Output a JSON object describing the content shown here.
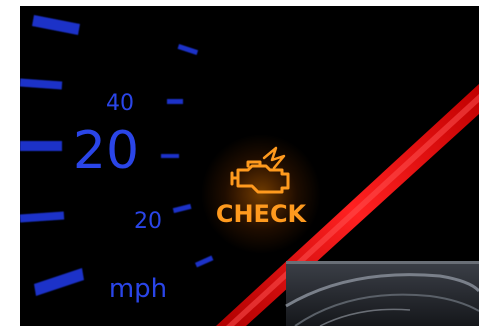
{
  "dashboard": {
    "speed_numbers": [
      "20",
      "40"
    ],
    "rpm_number": "20",
    "unit_label": "mph",
    "warning_light": {
      "icon": "engine-icon",
      "label": "CHECK",
      "color": "#ff9a1e"
    },
    "colors": {
      "gauge_blue": "#2a45e8",
      "needle_red": "#e01010",
      "background": "#000000"
    }
  }
}
